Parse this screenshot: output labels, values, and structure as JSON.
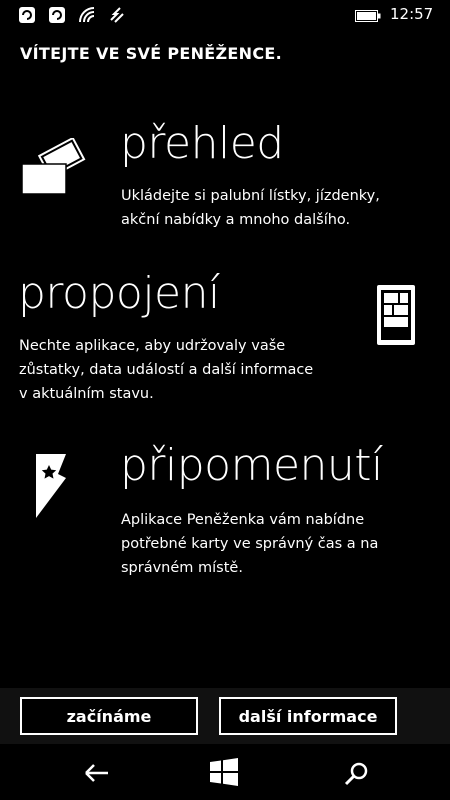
{
  "status": {
    "time": "12:57",
    "icons": [
      "notification-icon",
      "notification-icon",
      "wifi-icon",
      "data-icon",
      "battery-icon"
    ]
  },
  "header": {
    "title": "VÍTEJTE VE SVÉ PENĚŽENCE."
  },
  "features": [
    {
      "title": "přehled",
      "description": "Ukládejte si palubní lístky, jízdenky,\nakční nabídky a mnoho dalšího.",
      "icon": "cards-icon"
    },
    {
      "title": "propojení",
      "description": "Nechte aplikace, aby udržovaly vaše\nzůstatky, data událostí a další informace\nv aktuálním stavu.",
      "icon": "phone-apps-icon"
    },
    {
      "title": "připomenutí",
      "description": "Aplikace Peněženka vám nabídne\npotřebné karty ve správný čas a na\nsprávném místě.",
      "icon": "star-ticket-icon"
    }
  ],
  "actions": {
    "start_label": "začínáme",
    "more_label": "další informace"
  },
  "nav": {
    "back": "back-arrow-icon",
    "home": "windows-logo-icon",
    "search": "search-icon"
  }
}
